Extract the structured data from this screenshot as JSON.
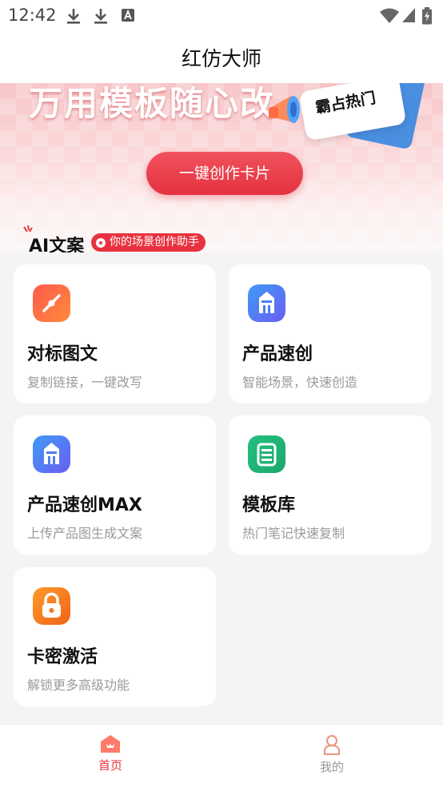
{
  "status_bar": {
    "time": "12:42",
    "icons": [
      "download-icon",
      "download-icon",
      "font-icon",
      "wifi-icon",
      "signal-icon",
      "battery-icon"
    ]
  },
  "header": {
    "title": "红仿大师"
  },
  "banner": {
    "headline": "万用模板随心改",
    "hot_badge": "霸占热门",
    "cta_label": "一键创作卡片",
    "section_title": "AI文案",
    "section_chip": "你的场景创作助手"
  },
  "features": [
    {
      "title": "对标图文",
      "subtitle": "复制链接，一键改写",
      "icon": "link-icon",
      "color": "#ff6a4a"
    },
    {
      "title": "产品速创",
      "subtitle": "智能场景，快速创造",
      "icon": "shop-icon",
      "color": "#4f7bf2"
    },
    {
      "title": "产品速创MAX",
      "subtitle": "上传产品图生成文案",
      "icon": "shop-icon",
      "color": "#4f7bf2"
    },
    {
      "title": "模板库",
      "subtitle": "热门笔记快速复制",
      "icon": "template-icon",
      "color": "#26b57a"
    },
    {
      "title": "卡密激活",
      "subtitle": "解锁更多高级功能",
      "icon": "lock-icon",
      "color": "#f47a1f"
    }
  ],
  "bottom_nav": {
    "items": [
      {
        "label": "首页",
        "icon": "home-icon",
        "active": true
      },
      {
        "label": "我的",
        "icon": "profile-icon",
        "active": false
      }
    ],
    "active_color": "#e8323f",
    "inactive_color": "#999999"
  }
}
